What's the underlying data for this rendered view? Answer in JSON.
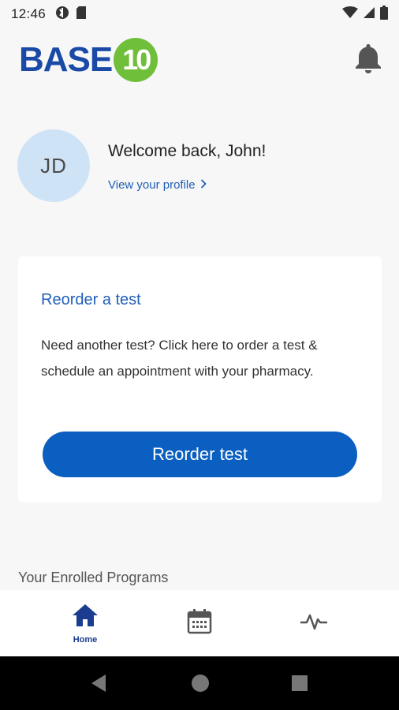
{
  "status": {
    "time": "12:46"
  },
  "header": {
    "logo_text": "BASE",
    "logo_badge": "10"
  },
  "profile": {
    "initials": "JD",
    "welcome": "Welcome back, John!",
    "link_label": "View your profile"
  },
  "reorder_card": {
    "title": "Reorder a test",
    "body": "Need another test? Click here to order a test & schedule an appointment with your pharmacy.",
    "button_label": "Reorder test"
  },
  "programs": {
    "section_title": "Your Enrolled Programs"
  },
  "tabs": [
    {
      "label": "Home",
      "icon": "home-icon",
      "active": true
    },
    {
      "label": "",
      "icon": "calendar-icon",
      "active": false
    },
    {
      "label": "",
      "icon": "activity-icon",
      "active": false
    }
  ],
  "colors": {
    "accent": "#0a5fc1",
    "link": "#1f5fb8",
    "brand_blue": "#1a4aa6",
    "brand_green": "#6fbf3a",
    "avatar_bg": "#cfe3f6"
  }
}
